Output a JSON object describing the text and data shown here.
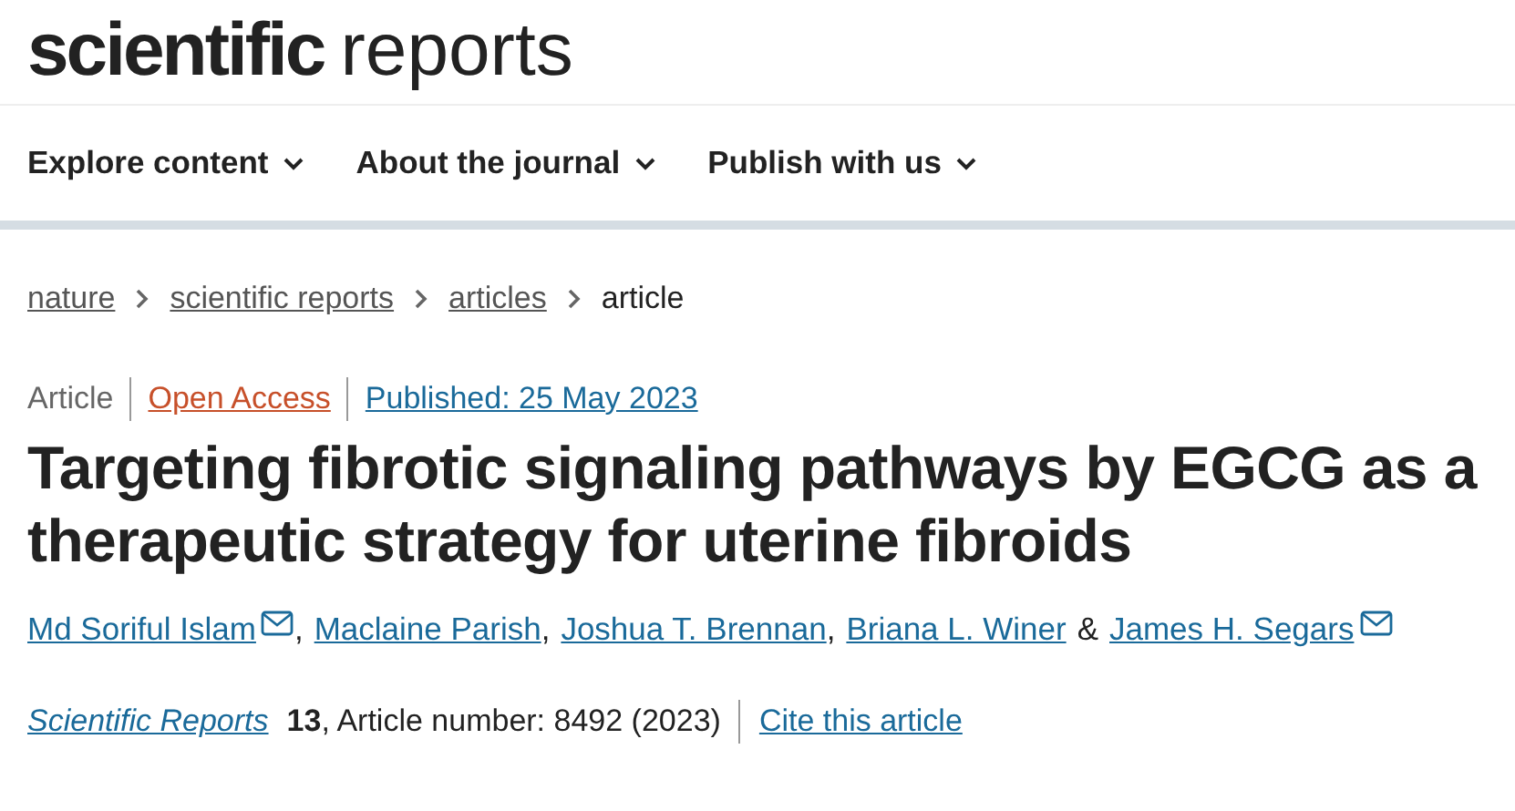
{
  "logo": {
    "bold": "scientific",
    "light": "reports"
  },
  "nav": [
    {
      "label": "Explore content"
    },
    {
      "label": "About the journal"
    },
    {
      "label": "Publish with us"
    }
  ],
  "breadcrumbs": [
    {
      "label": "nature",
      "link": true
    },
    {
      "label": "scientific reports",
      "link": true
    },
    {
      "label": "articles",
      "link": true
    },
    {
      "label": "article",
      "link": false
    }
  ],
  "meta": {
    "type": "Article",
    "access": "Open Access",
    "published": "Published: 25 May 2023"
  },
  "title": "Targeting fibrotic signaling pathways by EGCG as a therapeutic strategy for uterine fibroids",
  "authors": [
    {
      "name": "Md Soriful Islam",
      "mail": true
    },
    {
      "before": ",",
      "name": "Maclaine Parish",
      "mail": false
    },
    {
      "before": ",",
      "name": "Joshua T. Brennan",
      "mail": false
    },
    {
      "before": ",",
      "name": "Briana L. Winer",
      "mail": false
    },
    {
      "before": "&",
      "name": "James H. Segars",
      "mail": true
    }
  ],
  "citation": {
    "journal": "Scientific Reports",
    "details": "**13**, Article number: 8492 (2023)",
    "cite": "Cite this article"
  }
}
